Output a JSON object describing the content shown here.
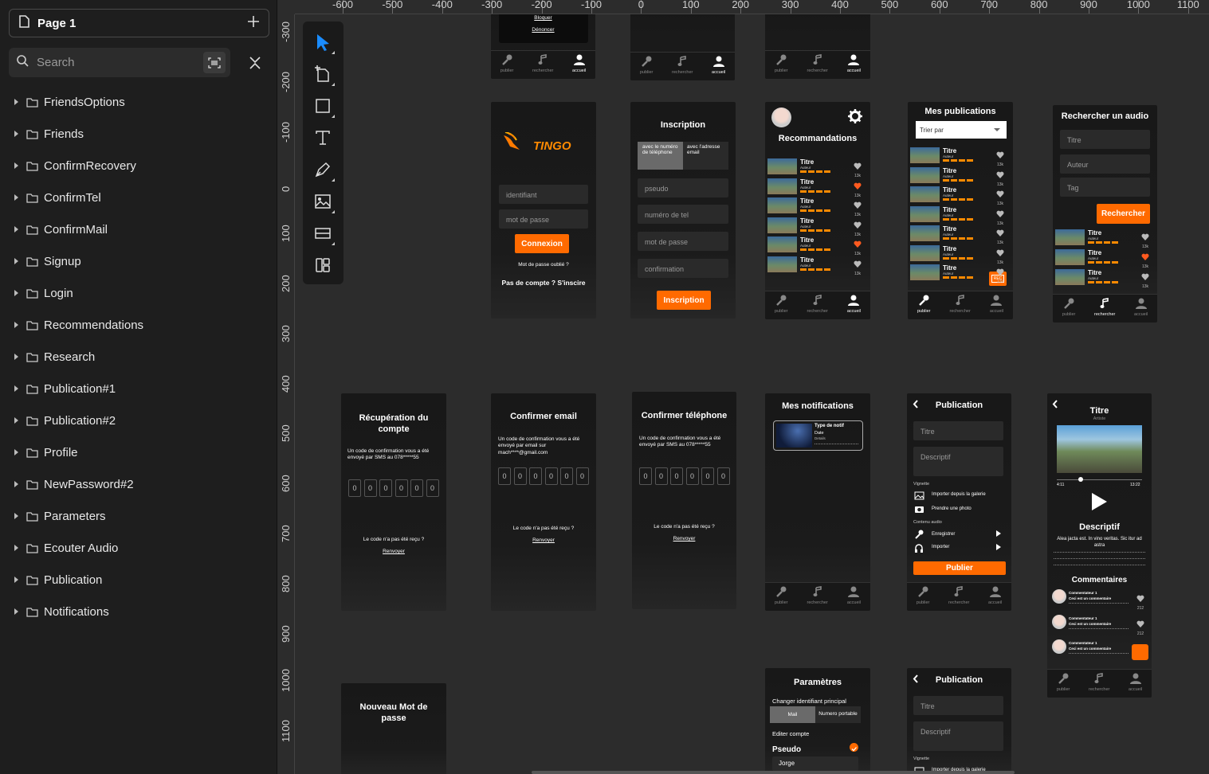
{
  "page_selector": {
    "label": "Page 1"
  },
  "search": {
    "placeholder": "Search"
  },
  "layers": [
    "FriendsOptions",
    "Friends",
    "ConfirmRecovery",
    "ConfirmTel",
    "ConfirmMail",
    "Signup",
    "Login",
    "Recommendations",
    "Research",
    "Publication#1",
    "Publication#2",
    "Profile",
    "NewPassword#2",
    "Parameters",
    "Ecouter Audio",
    "Publication",
    "Notifications"
  ],
  "ruler_top": [
    "-600",
    "-500",
    "-400",
    "-300",
    "-200",
    "-100",
    "0",
    "100",
    "200",
    "300",
    "400",
    "500",
    "600",
    "700",
    "800",
    "900",
    "1000",
    "1100"
  ],
  "ruler_left": [
    "-300",
    "-200",
    "-100",
    "0",
    "100",
    "200",
    "300",
    "400",
    "500",
    "600",
    "700",
    "800",
    "900",
    "1000",
    "1100"
  ],
  "nav": {
    "publier": "publier",
    "rechercher": "rechercher",
    "accueil": "accueil"
  },
  "top_partial": {
    "bloquer": "Bloquer",
    "denoncer": "Dénoncer"
  },
  "login": {
    "brand": "TINGO",
    "identifiant": "identifiant",
    "password": "mot de passe",
    "button": "Connexion",
    "forgot": "Mot de passe oublié ?",
    "signup": "Pas de compte ? S'inscire"
  },
  "signup": {
    "title": "Inscription",
    "tab_phone": "avec le numéro de téléphone",
    "tab_email": "avec l'adresse email",
    "pseudo": "pseudo",
    "tel": "numéro de tel",
    "password": "mot de passe",
    "confirm": "confirmation",
    "button": "Inscription"
  },
  "recommendations": {
    "title": "Recommandations"
  },
  "track": {
    "title": "Titre",
    "author": "Auteur",
    "likes": "13k"
  },
  "mypubs": {
    "title": "Mes publications",
    "sort": "Trier par",
    "rec": "REC"
  },
  "research": {
    "title": "Rechercher un audio",
    "titre": "Titre",
    "auteur": "Auteur",
    "tag": "Tag",
    "button": "Rechercher"
  },
  "recovery": {
    "title": "Récupération du compte",
    "text": "Un code de confirmation vous a été envoyé par SMS au 078*****55",
    "not_received": "Le code n'a pas été reçu ?",
    "resend": "Renvoyer"
  },
  "confirm_mail": {
    "title": "Confirmer email",
    "text": "Un code de confirmation vous a été envoyé par email sur mach****@gmail.com",
    "not_received": "Le code n'a pas été reçu ?",
    "resend": "Renvoyer"
  },
  "confirm_tel": {
    "title": "Confirmer téléphone",
    "text": "Un code de confirmation vous a été envoyé par SMS au 078*****55",
    "not_received": "Le code n'a pas été reçu ?",
    "resend": "Renvoyer"
  },
  "code_digit": "0",
  "notifications": {
    "title": "Mes notifications",
    "type": "Type de notif",
    "date": "Date",
    "details": "Details"
  },
  "publication": {
    "title": "Publication",
    "titre": "Titre",
    "descriptif": "Descriptif",
    "vignette": "Vignette",
    "gallery": "Importer depuis la galerie",
    "photo": "Prendre une photo",
    "contenu": "Contenu audio",
    "record": "Enregistrer",
    "import": "Importer",
    "button": "Publier"
  },
  "player": {
    "title": "Titre",
    "artist": "Artiste",
    "time_start": "4:11",
    "time_end": "13:22",
    "desc_title": "Descriptif",
    "desc": "Alea jacta est. In vino veritas. Sic itur ad astra",
    "comments_title": "Commentaires",
    "commenter": "Commentateur 1",
    "comment": "Ceci est un commentaire",
    "likes": "212"
  },
  "new_password": {
    "title": "Nouveau Mot de passe"
  },
  "parameters": {
    "title": "Paramètres",
    "change_id": "Changer identifiant principal",
    "mail": "Mail",
    "phone": "Numero portable",
    "edit": "Editer compte",
    "pseudo": "Pseudo",
    "pseudo_value": "Jorge"
  },
  "colors": {
    "accent": "#ff6a00",
    "select": "#1a8cff",
    "heart": "#ff5a1f",
    "bg": "#2c2c2c"
  }
}
